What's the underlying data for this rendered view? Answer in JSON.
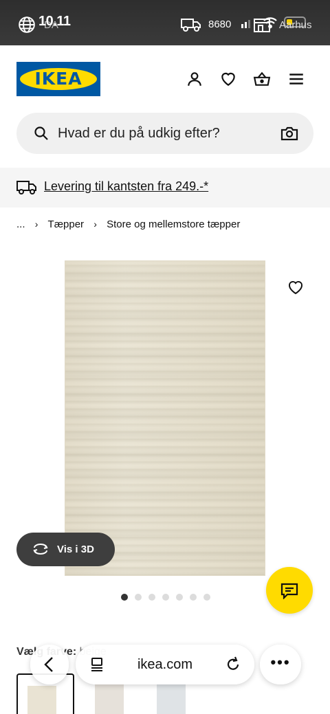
{
  "status_bar": {
    "time": "10.11",
    "language": "DA",
    "postal_code": "8680",
    "store": "Aarhus"
  },
  "header": {
    "logo_text": "IKEA",
    "icons": [
      "profile-icon",
      "heart-icon",
      "basket-icon",
      "menu-icon"
    ]
  },
  "search": {
    "placeholder": "Hvad er du på udkig efter?"
  },
  "banner": {
    "text": "Levering til kantsten fra 249.-*"
  },
  "breadcrumb": {
    "ellipsis": "...",
    "items": [
      "Tæpper",
      "Store og mellemstore tæpper"
    ]
  },
  "product": {
    "view_3d_label": "Vis i 3D",
    "image_count": 7,
    "active_image": 1
  },
  "color_section": {
    "label": "Vælg farve:",
    "selected": "beige"
  },
  "browser": {
    "url": "ikea.com"
  },
  "colors": {
    "ikea_blue": "#0058a3",
    "ikea_yellow": "#ffdb00"
  }
}
